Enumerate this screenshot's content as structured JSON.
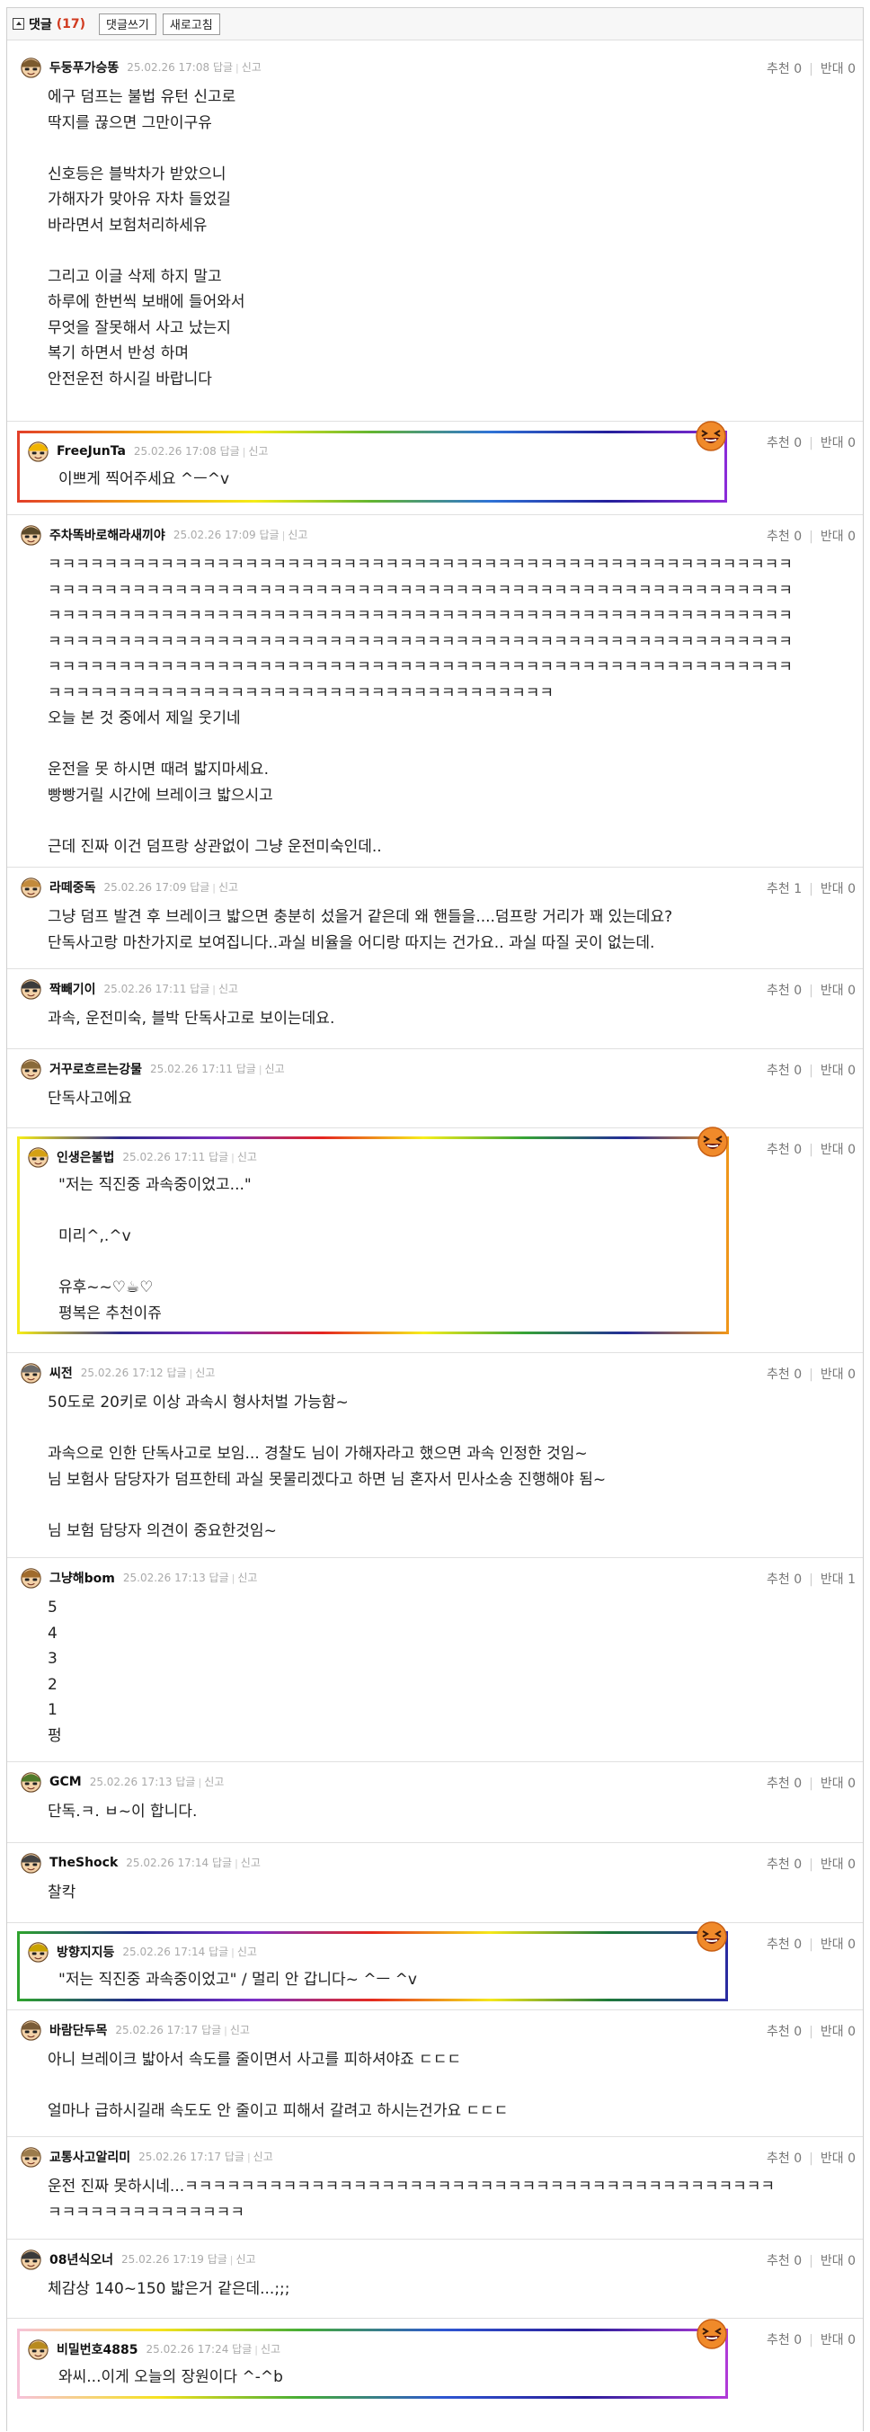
{
  "toolbar": {
    "comments_label": "댓글",
    "comments_count": "(17)",
    "write_button": "댓글쓰기",
    "refresh_button": "새로고침"
  },
  "labels": {
    "reply": "답글",
    "report": "신고",
    "upvote": "추천",
    "downvote": "반대"
  },
  "colors": {
    "count_accent": "#d13b20",
    "meta_text": "#aaaaaa",
    "rainbow_frame": [
      "#e23f29",
      "#f1a114",
      "#f5ec18",
      "#62b531",
      "#2f73d6",
      "#24209b",
      "#8a2bd8"
    ]
  },
  "comments": [
    {
      "nick": "두둥푸가승똥",
      "date": "25.02.26 17:08",
      "up": "0",
      "down": "0",
      "avatar": "avatar-icon",
      "text": "에구 덤프는 불법 유턴 신고로\n딱지를 끊으면 그만이구유\n\n신호등은 블박차가 받았으니\n가해자가 맞아유 자차 들었길\n바라면서 보험처리하세유\n\n그리고 이글 삭제 하지 말고\n하루에 한번씩 보배에 들어와서\n무엇을 잘못해서 사고 났는지\n복기 하면서 반성 하며\n안전운전 하시길 바랍니다"
    },
    {
      "nick": "FreeJunTa",
      "date": "25.02.26 17:08",
      "up": "0",
      "down": "0",
      "avatar": "avatar-icon",
      "text": "이쁘게 찍어주세요 ^ㅡ^v",
      "boxed": true
    },
    {
      "nick": "주차똑바로해라새끼야",
      "date": "25.02.26 17:09",
      "up": "0",
      "down": "0",
      "avatar": "avatar-icon",
      "text": "ㅋㅋㅋㅋㅋㅋㅋㅋㅋㅋㅋㅋㅋㅋㅋㅋㅋㅋㅋㅋㅋㅋㅋㅋㅋㅋㅋㅋㅋㅋㅋㅋㅋㅋㅋㅋㅋㅋㅋㅋㅋㅋㅋㅋㅋㅋㅋㅋㅋㅋㅋㅋㅋ\nㅋㅋㅋㅋㅋㅋㅋㅋㅋㅋㅋㅋㅋㅋㅋㅋㅋㅋㅋㅋㅋㅋㅋㅋㅋㅋㅋㅋㅋㅋㅋㅋㅋㅋㅋㅋㅋㅋㅋㅋㅋㅋㅋㅋㅋㅋㅋㅋㅋㅋㅋㅋㅋ\nㅋㅋㅋㅋㅋㅋㅋㅋㅋㅋㅋㅋㅋㅋㅋㅋㅋㅋㅋㅋㅋㅋㅋㅋㅋㅋㅋㅋㅋㅋㅋㅋㅋㅋㅋㅋㅋㅋㅋㅋㅋㅋㅋㅋㅋㅋㅋㅋㅋㅋㅋㅋㅋ\nㅋㅋㅋㅋㅋㅋㅋㅋㅋㅋㅋㅋㅋㅋㅋㅋㅋㅋㅋㅋㅋㅋㅋㅋㅋㅋㅋㅋㅋㅋㅋㅋㅋㅋㅋㅋㅋㅋㅋㅋㅋㅋㅋㅋㅋㅋㅋㅋㅋㅋㅋㅋㅋ\nㅋㅋㅋㅋㅋㅋㅋㅋㅋㅋㅋㅋㅋㅋㅋㅋㅋㅋㅋㅋㅋㅋㅋㅋㅋㅋㅋㅋㅋㅋㅋㅋㅋㅋㅋㅋㅋㅋㅋㅋㅋㅋㅋㅋㅋㅋㅋㅋㅋㅋㅋㅋㅋ\nㅋㅋㅋㅋㅋㅋㅋㅋㅋㅋㅋㅋㅋㅋㅋㅋㅋㅋㅋㅋㅋㅋㅋㅋㅋㅋㅋㅋㅋㅋㅋㅋㅋㅋㅋㅋ\n오늘 본 것 중에서 제일 웃기네\n\n운전을 못 하시면 때려 밟지마세요.\n빵빵거릴 시간에 브레이크 밟으시고\n\n근데 진짜 이건 덤프랑 상관없이 그냥 운전미숙인데.."
    },
    {
      "nick": "라떼중독",
      "date": "25.02.26 17:09",
      "up": "1",
      "down": "0",
      "avatar": "avatar-icon",
      "text": "그냥 덤프 발견 후 브레이크 밟으면 충분히 섰을거 같은데 왜 핸들을....덤프랑 거리가 꽤 있는데요?\n단독사고랑 마찬가지로 보여집니다..과실 비율을 어디랑 따지는 건가요.. 과실 따질 곳이 없는데."
    },
    {
      "nick": "짝빼기이",
      "date": "25.02.26 17:11",
      "up": "0",
      "down": "0",
      "avatar": "avatar-icon",
      "text": "과속, 운전미숙, 블박 단독사고로 보이는데요."
    },
    {
      "nick": "거꾸로흐르는강물",
      "date": "25.02.26 17:11",
      "up": "0",
      "down": "0",
      "avatar": "avatar-icon",
      "text": "단독사고에요"
    },
    {
      "nick": "인생은불법",
      "date": "25.02.26 17:11",
      "up": "0",
      "down": "0",
      "avatar": "avatar-icon",
      "text": "\"저는 직진중 과속중이었고...\"\n\n미리^,.^v\n\n유후~~♡☕♡\n평복은 추천이쥬",
      "boxed": true
    },
    {
      "nick": "씨전",
      "date": "25.02.26 17:12",
      "up": "0",
      "down": "0",
      "avatar": "avatar-icon",
      "text": "50도로 20키로 이상 과속시 형사처벌 가능함~\n\n과속으로 인한 단독사고로 보임... 경찰도 님이 가해자라고 했으면 과속 인정한 것임~\n님 보험사 담당자가 덤프한테 과실 못물리겠다고 하면 님 혼자서 민사소송 진행해야 됨~\n\n님 보험 담당자 의견이 중요한것임~"
    },
    {
      "nick": "그냥해bom",
      "date": "25.02.26 17:13",
      "up": "0",
      "down": "1",
      "avatar": "avatar-icon",
      "text": "5\n4\n3\n2\n1\n펑"
    },
    {
      "nick": "GCM",
      "date": "25.02.26 17:13",
      "up": "0",
      "down": "0",
      "avatar": "avatar-icon",
      "text": "단독.ㅋ. ㅂ~이 합니다."
    },
    {
      "nick": "TheShock",
      "date": "25.02.26 17:14",
      "up": "0",
      "down": "0",
      "avatar": "avatar-icon",
      "text": "찰칵"
    },
    {
      "nick": "방향지지등",
      "date": "25.02.26 17:14",
      "up": "0",
      "down": "0",
      "avatar": "avatar-icon",
      "text": "\"저는 직진중 과속중이었고\" / 멀리 안 갑니다~ ^ㅡ ^v",
      "boxed": true
    },
    {
      "nick": "바람단두목",
      "date": "25.02.26 17:17",
      "up": "0",
      "down": "0",
      "avatar": "avatar-icon",
      "text": "아니 브레이크 밟아서 속도를 줄이면서 사고를 피하셔야죠 ㄷㄷㄷ\n\n얼마나 급하시길래 속도도 안 줄이고 피해서 갈려고 하시는건가요 ㄷㄷㄷ"
    },
    {
      "nick": "교통사고알리미",
      "date": "25.02.26 17:17",
      "up": "0",
      "down": "0",
      "avatar": "avatar-icon",
      "text": "운전 진짜 못하시네...ㅋㅋㅋㅋㅋㅋㅋㅋㅋㅋㅋㅋㅋㅋㅋㅋㅋㅋㅋㅋㅋㅋㅋㅋㅋㅋㅋㅋㅋㅋㅋㅋㅋㅋㅋㅋㅋㅋㅋㅋㅋㅋ\nㅋㅋㅋㅋㅋㅋㅋㅋㅋㅋㅋㅋㅋㅋ"
    },
    {
      "nick": "08년식오너",
      "date": "25.02.26 17:19",
      "up": "0",
      "down": "0",
      "avatar": "avatar-icon",
      "text": "체감상 140~150 밟은거 같은데...;;;"
    },
    {
      "nick": "비밀번호4885",
      "date": "25.02.26 17:24",
      "up": "0",
      "down": "0",
      "avatar": "avatar-icon",
      "text": "와씨...이게 오늘의 장원이다 ^-^b",
      "boxed": true
    }
  ]
}
